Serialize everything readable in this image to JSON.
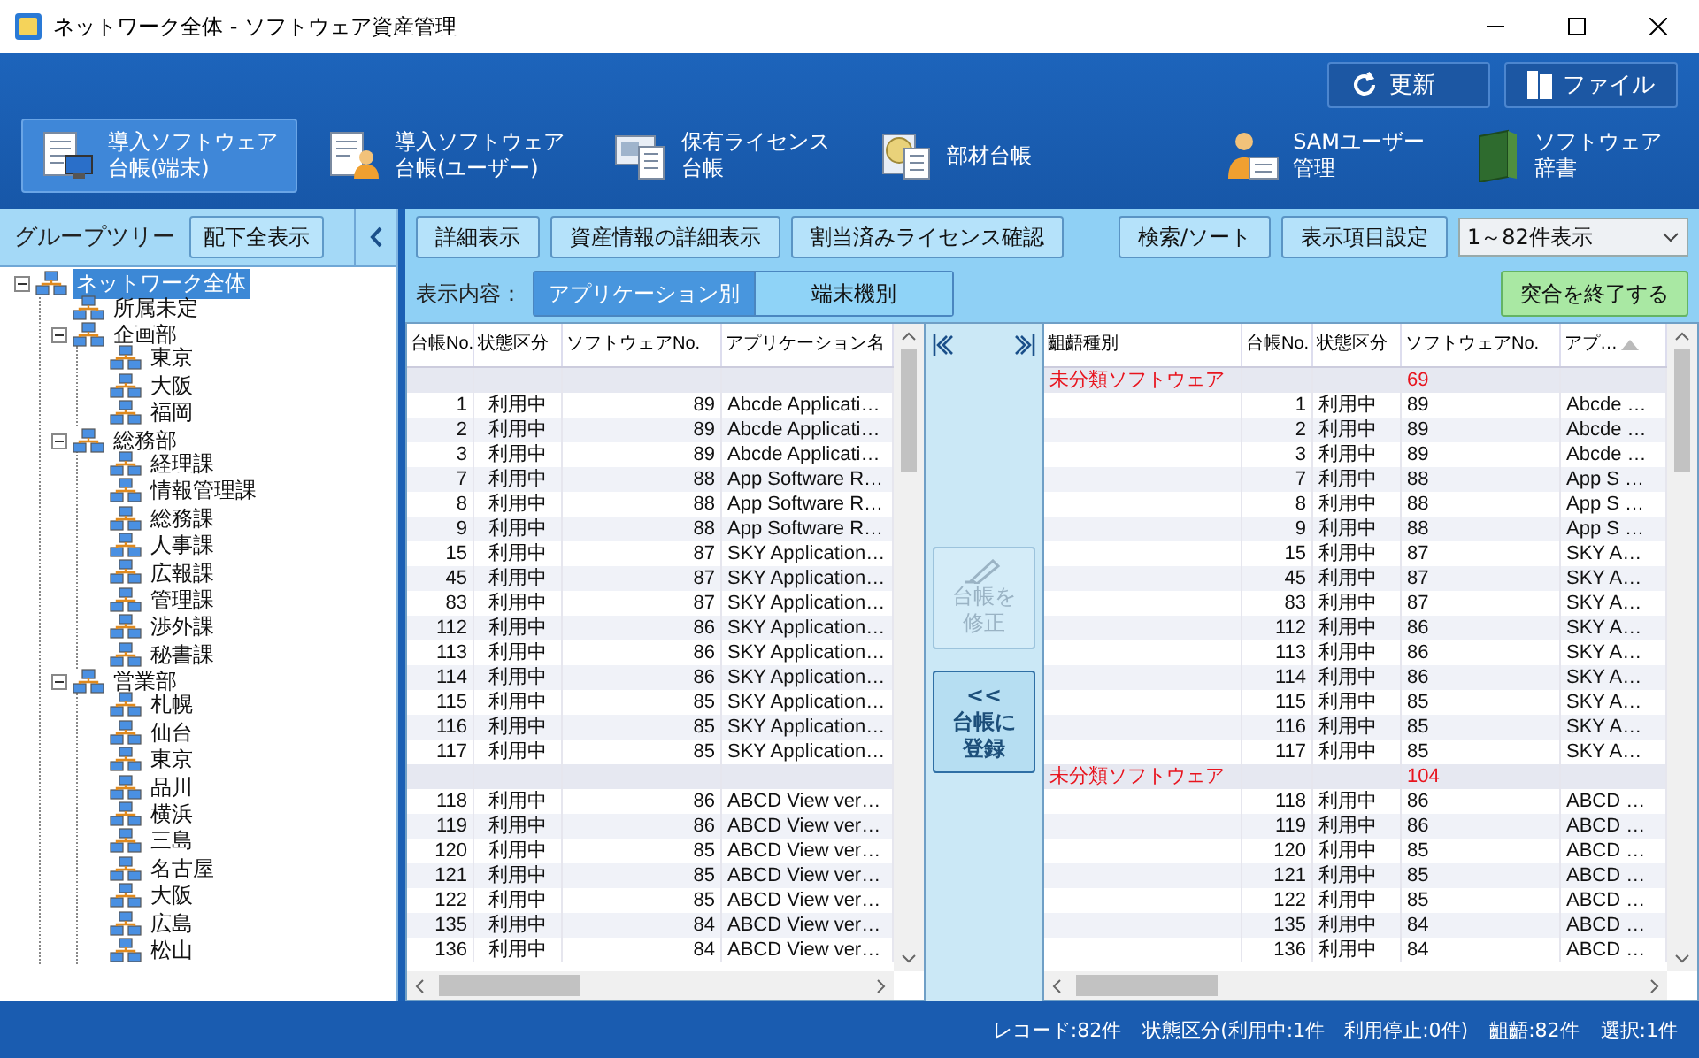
{
  "window": {
    "title": "ネットワーク全体 - ソフトウェア資産管理"
  },
  "top_buttons": [
    {
      "label": "更新"
    },
    {
      "label": "ファイル"
    }
  ],
  "nav": [
    {
      "lines": [
        "導入ソフトウェア",
        "台帳(端末)"
      ],
      "selected": true
    },
    {
      "lines": [
        "導入ソフトウェア",
        "台帳(ユーザー)"
      ],
      "selected": false
    },
    {
      "lines": [
        "保有ライセンス",
        "台帳"
      ],
      "selected": false
    },
    {
      "lines": [
        "部材台帳"
      ],
      "selected": false
    },
    {
      "lines": [
        "SAMユーザー",
        "管理"
      ],
      "selected": false
    },
    {
      "lines": [
        "ソフトウェア",
        "辞書"
      ],
      "selected": false
    }
  ],
  "group_tree": {
    "title": "グループツリー",
    "button": "配下全表示",
    "root": {
      "label": "ネットワーク全体",
      "selected": true,
      "expanded": true,
      "children": [
        {
          "label": "所属未定",
          "selected": false
        },
        {
          "label": "企画部",
          "selected": false,
          "expanded": true,
          "children": [
            {
              "label": "東京",
              "selected": false
            },
            {
              "label": "大阪",
              "selected": false
            },
            {
              "label": "福岡",
              "selected": false
            }
          ]
        },
        {
          "label": "総務部",
          "selected": false,
          "expanded": true,
          "children": [
            {
              "label": "経理課",
              "selected": false
            },
            {
              "label": "情報管理課",
              "selected": false
            },
            {
              "label": "総務課",
              "selected": false
            },
            {
              "label": "人事課",
              "selected": false
            },
            {
              "label": "広報課",
              "selected": false
            },
            {
              "label": "管理課",
              "selected": false
            },
            {
              "label": "渉外課",
              "selected": false
            },
            {
              "label": "秘書課",
              "selected": false
            }
          ]
        },
        {
          "label": "営業部",
          "selected": false,
          "expanded": true,
          "children": [
            {
              "label": "札幌",
              "selected": false
            },
            {
              "label": "仙台",
              "selected": false
            },
            {
              "label": "東京",
              "selected": false
            },
            {
              "label": "品川",
              "selected": false
            },
            {
              "label": "横浜",
              "selected": false
            },
            {
              "label": "三島",
              "selected": false
            },
            {
              "label": "名古屋",
              "selected": false
            },
            {
              "label": "大阪",
              "selected": false
            },
            {
              "label": "広島",
              "selected": false
            },
            {
              "label": "松山",
              "selected": false
            }
          ]
        }
      ]
    }
  },
  "toolbar": {
    "left_buttons": [
      "詳細表示",
      "資産情報の詳細表示",
      "割当済みライセンス確認"
    ],
    "right_buttons": [
      "検索/ソート",
      "表示項目設定"
    ],
    "range_select": {
      "value": "1～82件表示"
    }
  },
  "display_mode": {
    "label": "表示内容：",
    "options": [
      {
        "label": "アプリケーション別",
        "selected": true
      },
      {
        "label": "端末機別",
        "selected": false
      }
    ],
    "finish_button": "突合を終了する"
  },
  "left_table": {
    "columns": [
      "台帳No.",
      "状態区分",
      "ソフトウェアNo.",
      "アプリケーション名"
    ],
    "rows": [
      {
        "kind": "group"
      },
      {
        "kind": "item",
        "cells": [
          "1",
          "利用中",
          "89",
          "Abcde Applicati…"
        ]
      },
      {
        "kind": "item",
        "cells": [
          "2",
          "利用中",
          "89",
          "Abcde Applicati…"
        ]
      },
      {
        "kind": "item",
        "cells": [
          "3",
          "利用中",
          "89",
          "Abcde Applicati…"
        ]
      },
      {
        "kind": "item",
        "cells": [
          "7",
          "利用中",
          "88",
          "App Software R…"
        ]
      },
      {
        "kind": "item",
        "cells": [
          "8",
          "利用中",
          "88",
          "App Software R…"
        ]
      },
      {
        "kind": "item",
        "cells": [
          "9",
          "利用中",
          "88",
          "App Software R…"
        ]
      },
      {
        "kind": "item",
        "cells": [
          "15",
          "利用中",
          "87",
          "SKY Application…"
        ]
      },
      {
        "kind": "item",
        "cells": [
          "45",
          "利用中",
          "87",
          "SKY Application…"
        ]
      },
      {
        "kind": "item",
        "cells": [
          "83",
          "利用中",
          "87",
          "SKY Application…"
        ]
      },
      {
        "kind": "item",
        "cells": [
          "112",
          "利用中",
          "86",
          "SKY Application…"
        ]
      },
      {
        "kind": "item",
        "cells": [
          "113",
          "利用中",
          "86",
          "SKY Application…"
        ]
      },
      {
        "kind": "item",
        "cells": [
          "114",
          "利用中",
          "86",
          "SKY Application…"
        ]
      },
      {
        "kind": "item",
        "cells": [
          "115",
          "利用中",
          "85",
          "SKY Application…"
        ]
      },
      {
        "kind": "item",
        "cells": [
          "116",
          "利用中",
          "85",
          "SKY Application…"
        ]
      },
      {
        "kind": "item",
        "cells": [
          "117",
          "利用中",
          "85",
          "SKY Application…"
        ]
      },
      {
        "kind": "group"
      },
      {
        "kind": "item",
        "cells": [
          "118",
          "利用中",
          "86",
          "ABCD View ver…"
        ]
      },
      {
        "kind": "item",
        "cells": [
          "119",
          "利用中",
          "86",
          "ABCD View ver…"
        ]
      },
      {
        "kind": "item",
        "cells": [
          "120",
          "利用中",
          "85",
          "ABCD View ver…"
        ]
      },
      {
        "kind": "item",
        "cells": [
          "121",
          "利用中",
          "85",
          "ABCD View ver…"
        ]
      },
      {
        "kind": "item",
        "cells": [
          "122",
          "利用中",
          "85",
          "ABCD View ver…"
        ]
      },
      {
        "kind": "item",
        "cells": [
          "135",
          "利用中",
          "84",
          "ABCD View ver…"
        ]
      },
      {
        "kind": "item",
        "cells": [
          "136",
          "利用中",
          "84",
          "ABCD View ver…"
        ]
      }
    ]
  },
  "transfer": {
    "edit_button": {
      "lines": [
        "台帳を",
        "修正"
      ],
      "disabled": true
    },
    "register_button": {
      "arrow": "<<",
      "lines": [
        "台帳に",
        "登録"
      ],
      "disabled": false
    }
  },
  "right_table": {
    "columns": [
      "齟齬種別",
      "台帳No.",
      "状態区分",
      "ソフトウェアNo.",
      "アプ…"
    ],
    "rows": [
      {
        "kind": "group",
        "category": "未分類ソフトウェア",
        "count": "69"
      },
      {
        "kind": "item",
        "cells": [
          "1",
          "利用中",
          "89",
          "Abcde …"
        ]
      },
      {
        "kind": "item",
        "cells": [
          "2",
          "利用中",
          "89",
          "Abcde …"
        ]
      },
      {
        "kind": "item",
        "cells": [
          "3",
          "利用中",
          "89",
          "Abcde …"
        ]
      },
      {
        "kind": "item",
        "cells": [
          "7",
          "利用中",
          "88",
          "App S …"
        ]
      },
      {
        "kind": "item",
        "cells": [
          "8",
          "利用中",
          "88",
          "App S …"
        ]
      },
      {
        "kind": "item",
        "cells": [
          "9",
          "利用中",
          "88",
          "App S …"
        ]
      },
      {
        "kind": "item",
        "cells": [
          "15",
          "利用中",
          "87",
          "SKY A…"
        ]
      },
      {
        "kind": "item",
        "cells": [
          "45",
          "利用中",
          "87",
          "SKY A…"
        ]
      },
      {
        "kind": "item",
        "cells": [
          "83",
          "利用中",
          "87",
          "SKY A…"
        ]
      },
      {
        "kind": "item",
        "cells": [
          "112",
          "利用中",
          "86",
          "SKY A…"
        ]
      },
      {
        "kind": "item",
        "cells": [
          "113",
          "利用中",
          "86",
          "SKY A…"
        ]
      },
      {
        "kind": "item",
        "cells": [
          "114",
          "利用中",
          "86",
          "SKY A…"
        ]
      },
      {
        "kind": "item",
        "cells": [
          "115",
          "利用中",
          "85",
          "SKY A…"
        ]
      },
      {
        "kind": "item",
        "cells": [
          "116",
          "利用中",
          "85",
          "SKY A…"
        ]
      },
      {
        "kind": "item",
        "cells": [
          "117",
          "利用中",
          "85",
          "SKY A…"
        ]
      },
      {
        "kind": "group",
        "category": "未分類ソフトウェア",
        "count": "104"
      },
      {
        "kind": "item",
        "cells": [
          "118",
          "利用中",
          "86",
          "ABCD …"
        ]
      },
      {
        "kind": "item",
        "cells": [
          "119",
          "利用中",
          "86",
          "ABCD …"
        ]
      },
      {
        "kind": "item",
        "cells": [
          "120",
          "利用中",
          "85",
          "ABCD …"
        ]
      },
      {
        "kind": "item",
        "cells": [
          "121",
          "利用中",
          "85",
          "ABCD …"
        ]
      },
      {
        "kind": "item",
        "cells": [
          "122",
          "利用中",
          "85",
          "ABCD …"
        ]
      },
      {
        "kind": "item",
        "cells": [
          "135",
          "利用中",
          "84",
          "ABCD …"
        ]
      },
      {
        "kind": "item",
        "cells": [
          "136",
          "利用中",
          "84",
          "ABCD …"
        ]
      }
    ]
  },
  "status_bar": {
    "items": [
      "レコード:82件",
      "状態区分(利用中:1件　利用停止:0件)",
      "齟齬:82件",
      "選択:1件"
    ]
  }
}
